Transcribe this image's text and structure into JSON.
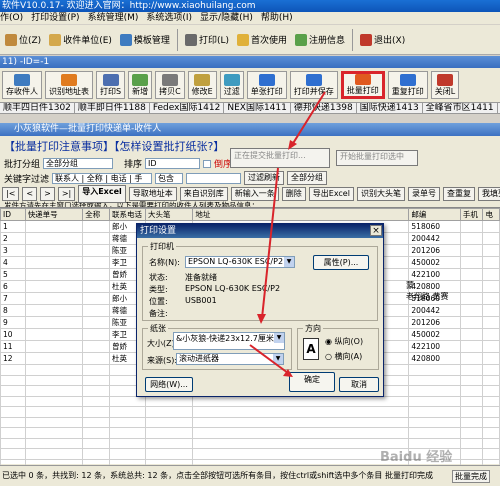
{
  "window": {
    "title": "软件V10.0.17- 欢迎进入官网：http://www.xiaohuilang.com",
    "menu": [
      "作(O)",
      "打印设置(P)",
      "系统管理(M)",
      "系统选项(I)",
      "显示/隐藏(H)",
      "帮助(H)"
    ]
  },
  "toolbar": {
    "items": [
      "位(Z)",
      "收件单位(E)",
      "模板管理",
      "打印(L)",
      "首次使用",
      "注册信息",
      "退出(X)"
    ]
  },
  "subwindow": {
    "title": "11)  -ID=-1"
  },
  "toolbar2": {
    "items": [
      "存收件人",
      "识别地址表",
      "打印S",
      "新增",
      "拷贝C",
      "修改E",
      "过滤",
      "单张打印",
      "打印并保存",
      "批量打印",
      "重复打印",
      "关闭L"
    ]
  },
  "status_strip": [
    "顺丰四日件1302",
    "顺丰即日件1188",
    "Fedex国际1412",
    "NEX国际1411",
    "德邦快递1398",
    "国际快递1413",
    "全峰省市区1411"
  ],
  "batch_dialog": {
    "title": "小灰狼软件—批量打印快递单-收件人",
    "notice": "【批量打印注意事项】【怎样设置批打纸张?】",
    "group_label": "批打分组",
    "group_value": "全部分组",
    "sort_label": "排序",
    "sort_value": "ID",
    "desc_label": "倒序",
    "keyword_label": "关键字过滤",
    "keyword_value": "联系人 | 全称 | 电话 | 手",
    "contains_value": "包含",
    "submit_btn": "正在提交批量打印...",
    "start_btn": "开始批量打印选中",
    "refresh_btn": "过滤刷新",
    "all_groups_btn": "全部分组",
    "tip": "发件方请先在主窗口选择或输入，以下是需要打印的收件人列表及物品信息：",
    "nav": [
      "|<",
      "<",
      ">",
      ">|"
    ],
    "import_excel": "导入Excel",
    "row_buttons": [
      "导取地址本",
      "来自识别库",
      "新输入一条",
      "删除",
      "导出Excel",
      "识别大头笔",
      "录单号",
      "查重复",
      "我填列"
    ],
    "columns": [
      "ID",
      "快递单号",
      "全称",
      "联系电话",
      "大头笔",
      "地址",
      "邮编",
      "手机",
      "电"
    ],
    "rows": [
      {
        "id": "1",
        "name": "郎小",
        "zip": "518060"
      },
      {
        "id": "2",
        "name": "蒋德",
        "zip": "200442"
      },
      {
        "id": "3",
        "name": "陈亚",
        "zip": "201206"
      },
      {
        "id": "4",
        "name": "李卫",
        "zip": "450002"
      },
      {
        "id": "5",
        "name": "曾娇",
        "zip": "422100"
      },
      {
        "id": "6",
        "name": "杜英",
        "zip": "420800"
      },
      {
        "id": "7",
        "name": "郎小",
        "zip": "518060"
      },
      {
        "id": "8",
        "name": "蒋德",
        "zip": "200442"
      },
      {
        "id": "9",
        "name": "陈亚",
        "zip": "201206"
      },
      {
        "id": "10",
        "name": "李卫",
        "zip": "450002"
      },
      {
        "id": "11",
        "name": "曾娇",
        "zip": "422100"
      },
      {
        "id": "12",
        "name": "杜英",
        "zip": "420800"
      },
      {
        "id": "",
        "name": "",
        "zip": ""
      },
      {
        "id": "",
        "name": "",
        "zip": ""
      },
      {
        "id": "",
        "name": "",
        "zip": ""
      },
      {
        "id": "",
        "name": "",
        "zip": ""
      },
      {
        "id": "",
        "name": "",
        "zip": ""
      },
      {
        "id": "",
        "name": "",
        "zip": ""
      },
      {
        "id": "",
        "name": "",
        "zip": ""
      },
      {
        "id": "",
        "name": "",
        "zip": ""
      },
      {
        "id": "",
        "name": "",
        "zip": ""
      },
      {
        "id": "",
        "name": "",
        "zip": ""
      }
    ],
    "side_text": [
      "蒙",
      "老翔路 黄赛"
    ],
    "bottom": "已选中 0 条，共找到: 12 条，系统总共: 12 条，点击全部按钮可选所有条目，按住ctrl或shift选中多个条目 批量打印完成",
    "bottom_right": "批量完成",
    "watermark": "Baidu 经验"
  },
  "print_dialog": {
    "title": "打印设置",
    "printer_group": "打印机",
    "name_label": "名称(N):",
    "name_value": "EPSON LQ-630K ESC/P2",
    "props_btn": "属性(P)...",
    "status_label": "状态:",
    "status_value": "准备就绪",
    "type_label": "类型:",
    "type_value": "EPSON LQ-630K ESC/P2",
    "location_label": "位置:",
    "location_value": "USB001",
    "comment_label": "备注:",
    "paper_group": "纸张",
    "size_label": "大小(Z):",
    "size_value": "&小灰狼-快递23x12.7厘米",
    "source_label": "来源(S):",
    "source_value": "滚动进纸器",
    "orient_group": "方向",
    "portrait": "纵向(O)",
    "landscape": "横向(A)",
    "network_btn": "网络(W)...",
    "ok_btn": "确定",
    "cancel_btn": "取消"
  },
  "accent": "#d9242b"
}
